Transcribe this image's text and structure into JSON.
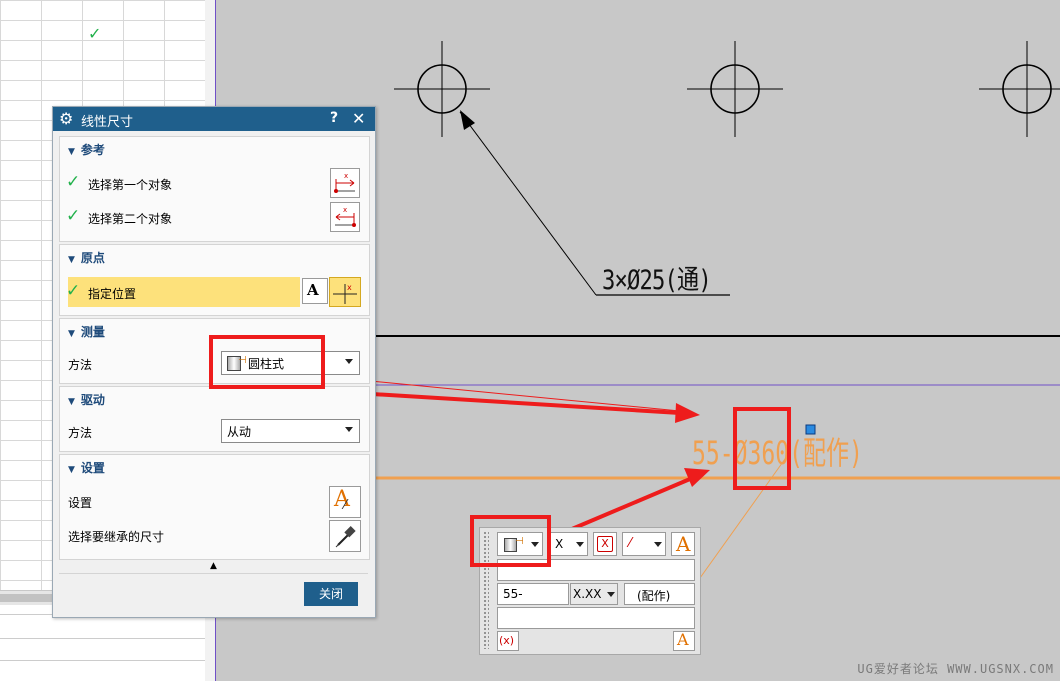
{
  "dialog": {
    "title": "线性尺寸",
    "help": "?",
    "close": "✕",
    "reference": {
      "header": "参考",
      "first_object": "选择第一个对象",
      "second_object": "选择第二个对象"
    },
    "origin": {
      "header": "原点",
      "specify_location": "指定位置"
    },
    "measurement": {
      "header": "测量",
      "method_label": "方法",
      "method_value": "圆柱式"
    },
    "driving": {
      "header": "驱动",
      "method_label": "方法",
      "method_value": "从动"
    },
    "settings": {
      "header": "设置",
      "settings_label": "设置",
      "inherit_label": "选择要继承的尺寸"
    },
    "close_button": "关闭"
  },
  "drawing": {
    "hole_note": "3×Ø25(通)",
    "dimension_text": "55-Ø360(配作)"
  },
  "toolbar": {
    "x_value": "X",
    "prefix_value": "55-",
    "tolerance_format": "X.XX",
    "suffix_value": "(配作)",
    "letter_a": "A",
    "expr_symbol": "(x)"
  },
  "watermark": "UG爱好者论坛 WWW.UGSNX.COM",
  "colors": {
    "title_bar": "#1f5f8c",
    "highlight": "#fde17b",
    "dimension_orange": "#f0a050",
    "annotation_red": "#ee1c1c",
    "check_green": "#22b14c"
  }
}
